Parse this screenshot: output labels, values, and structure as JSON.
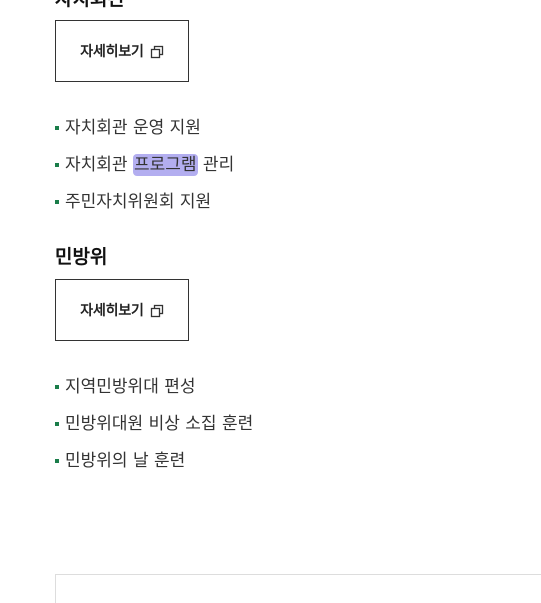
{
  "sections": [
    {
      "title": "자치회관",
      "detail_button_label": "자세히보기",
      "detail_button_icon": "external-link-icon",
      "items": [
        {
          "pre": "자치회관 운영 지원",
          "highlight": "",
          "post": ""
        },
        {
          "pre": "자치회관 ",
          "highlight": "프로그램",
          "post": " 관리"
        },
        {
          "pre": "주민자치위원회 지원",
          "highlight": "",
          "post": ""
        }
      ]
    },
    {
      "title": "민방위",
      "detail_button_label": "자세히보기",
      "detail_button_icon": "external-link-icon",
      "items": [
        {
          "pre": "지역민방위대 편성",
          "highlight": "",
          "post": ""
        },
        {
          "pre": "민방위대원 비상 소집 훈련",
          "highlight": "",
          "post": ""
        },
        {
          "pre": "민방위의 날 훈련",
          "highlight": "",
          "post": ""
        }
      ]
    }
  ],
  "colors": {
    "bullet": "#1a7d4a",
    "highlight": "#b3aef0",
    "button_border": "#333333"
  }
}
